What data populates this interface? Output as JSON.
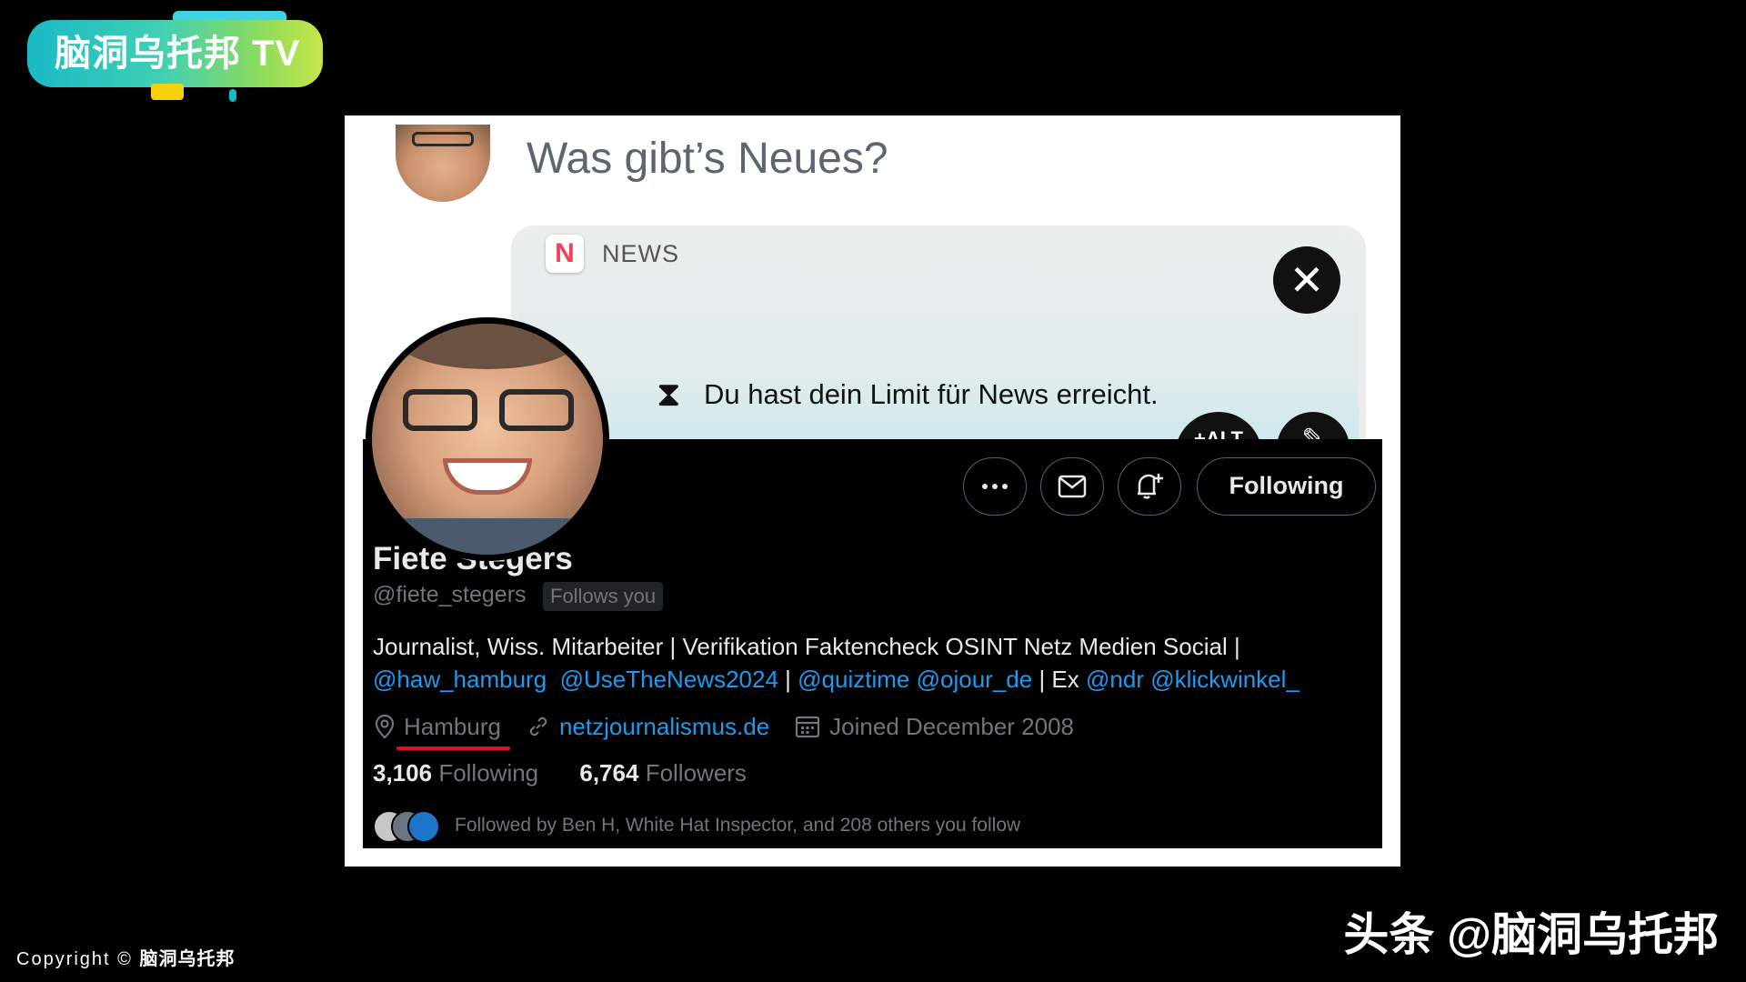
{
  "channel_logo": {
    "text": "脑洞乌托邦 TV"
  },
  "compose": {
    "placeholder": "Was gibt’s Neues?"
  },
  "news_card": {
    "source_label": "NEWS",
    "limit_message": "Du hast dein Limit für News erreicht.",
    "alt_button_label": "+ALT"
  },
  "profile": {
    "name": "Fiete Stegers",
    "handle": "@fiete_stegers",
    "follows_you_badge": "Follows you",
    "following_button": "Following",
    "bio": {
      "line1": "Journalist, Wiss. Mitarbeiter | Verifikation Faktencheck OSINT Netz Medien Social |",
      "mention_haw": "@haw_hamburg",
      "mention_usethenews": "@UseTheNews2024",
      "sep1": "|",
      "mention_quiztime": "@quiztime",
      "mention_ojour": "@ojour_de",
      "sep2": "| Ex",
      "mention_ndr": "@ndr",
      "mention_klickwinkel": "@klickwinkel_"
    },
    "location": "Hamburg",
    "website": "netzjournalismus.de",
    "joined": "Joined December 2008",
    "following_count": "3,106",
    "following_label": "Following",
    "followers_count": "6,764",
    "followers_label": "Followers",
    "followed_by_text": "Followed by Ben H, White Hat Inspector, and 208 others you follow"
  },
  "footer": {
    "copyright_prefix": "Copyright",
    "copyright_symbol": "©",
    "copyright_brand": "脑洞乌托邦",
    "watermark": "头条 @脑洞乌托邦"
  },
  "colors": {
    "link_blue": "#1d9bf0",
    "muted_gray": "#71767b",
    "highlight_underline": "#e8101e"
  },
  "icons": [
    "more-icon",
    "mail-icon",
    "bell-plus-icon",
    "location-pin-icon",
    "link-icon",
    "calendar-icon",
    "hourglass-icon",
    "close-icon",
    "edit-icon"
  ]
}
